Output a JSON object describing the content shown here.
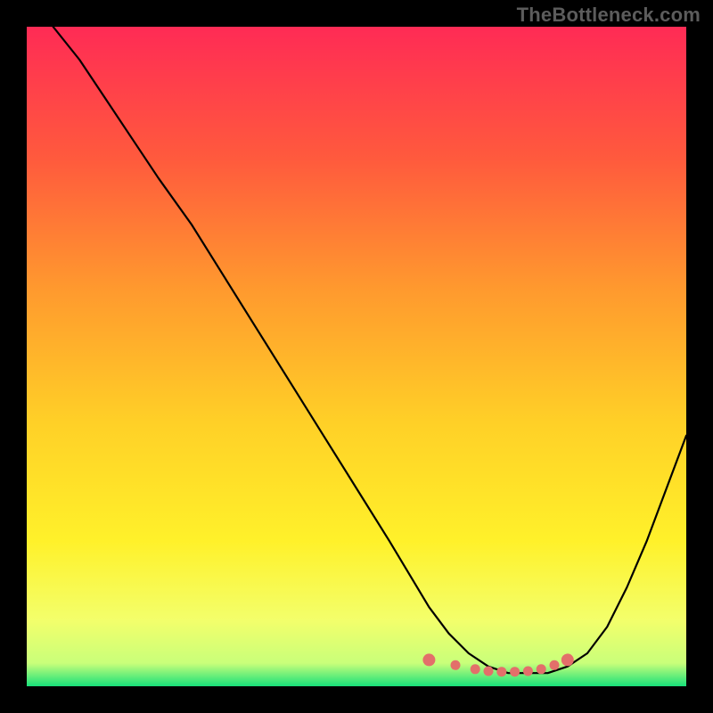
{
  "watermark": "TheBottleneck.com",
  "colors": {
    "frame": "#000000",
    "watermark": "#5c5c5c",
    "curve": "#000000",
    "marker": "#e36f6a",
    "gradient_stops": [
      {
        "offset": 0.0,
        "color": "#ff2b55"
      },
      {
        "offset": 0.2,
        "color": "#ff5a3d"
      },
      {
        "offset": 0.4,
        "color": "#ff9a2e"
      },
      {
        "offset": 0.6,
        "color": "#ffd027"
      },
      {
        "offset": 0.78,
        "color": "#fff12a"
      },
      {
        "offset": 0.9,
        "color": "#f3ff6b"
      },
      {
        "offset": 0.965,
        "color": "#c9ff7a"
      },
      {
        "offset": 1.0,
        "color": "#18e07a"
      }
    ]
  },
  "chart_data": {
    "type": "line",
    "title": "",
    "xlabel": "",
    "ylabel": "",
    "xlim": [
      0,
      100
    ],
    "ylim": [
      0,
      100
    ],
    "grid": false,
    "legend": false,
    "series": [
      {
        "name": "bottleneck-curve",
        "x": [
          4,
          8,
          12,
          16,
          20,
          25,
          30,
          35,
          40,
          45,
          50,
          55,
          58,
          61,
          64,
          67,
          70,
          73,
          76,
          79,
          82,
          85,
          88,
          91,
          94,
          97,
          100
        ],
        "y": [
          100,
          95,
          89,
          83,
          77,
          70,
          62,
          54,
          46,
          38,
          30,
          22,
          17,
          12,
          8,
          5,
          3,
          2,
          2,
          2,
          3,
          5,
          9,
          15,
          22,
          30,
          38
        ]
      }
    ],
    "markers": {
      "name": "highlight-dots",
      "x": [
        61,
        65,
        68,
        70,
        72,
        74,
        76,
        78,
        80,
        82
      ],
      "y": [
        4.0,
        3.2,
        2.6,
        2.3,
        2.2,
        2.2,
        2.3,
        2.6,
        3.2,
        4.0
      ]
    }
  }
}
